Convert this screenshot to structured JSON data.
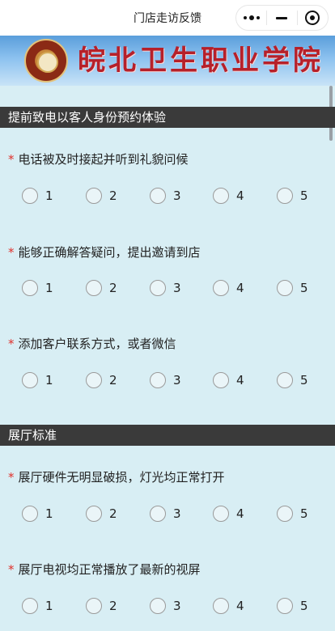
{
  "window": {
    "title": "门店走访反馈"
  },
  "capsule": {
    "more_icon": "more-dots-icon",
    "minimize_icon": "minus-icon",
    "close_icon": "target-icon"
  },
  "banner": {
    "school_name": "皖北卫生职业学院",
    "seal_icon": "school-seal-logo"
  },
  "colors": {
    "section_bg": "#3a3a3a",
    "page_bg": "#d8eef4",
    "required": "#e0302b",
    "banner_text": "#b6202a"
  },
  "sections": [
    {
      "title": "提前致电以客人身份预约体验",
      "questions": [
        {
          "required_mark": "*",
          "text": "电话被及时接起并听到礼貌问候",
          "options": [
            "1",
            "2",
            "3",
            "4",
            "5"
          ]
        },
        {
          "required_mark": "*",
          "text": "能够正确解答疑问，提出邀请到店",
          "options": [
            "1",
            "2",
            "3",
            "4",
            "5"
          ]
        },
        {
          "required_mark": "*",
          "text": "添加客户联系方式，或者微信",
          "options": [
            "1",
            "2",
            "3",
            "4",
            "5"
          ]
        }
      ]
    },
    {
      "title": "展厅标准",
      "questions": [
        {
          "required_mark": "*",
          "text": "展厅硬件无明显破损，灯光均正常打开",
          "options": [
            "1",
            "2",
            "3",
            "4",
            "5"
          ]
        },
        {
          "required_mark": "*",
          "text": "展厅电视均正常播放了最新的视屏",
          "options": [
            "1",
            "2",
            "3",
            "4",
            "5"
          ]
        }
      ]
    }
  ]
}
